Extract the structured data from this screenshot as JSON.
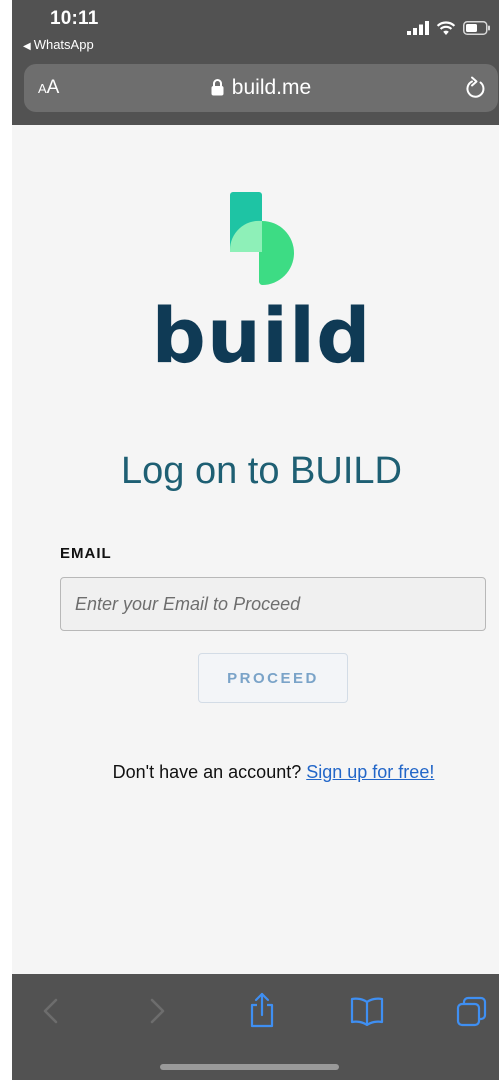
{
  "status_bar": {
    "time": "10:11",
    "back_app": "WhatsApp"
  },
  "browser": {
    "text_size_small": "A",
    "text_size_large": "A",
    "url": "build.me"
  },
  "logo": {
    "wordmark": "build",
    "colors": {
      "teal": "#1ec4a4",
      "light_green": "#8ef0b8",
      "green": "#3ddc84",
      "navy": "#0f3a55"
    }
  },
  "login": {
    "heading": "Log on to BUILD",
    "email_label": "EMAIL",
    "email_placeholder": "Enter your Email to Proceed",
    "email_value": "",
    "proceed_label": "PROCEED",
    "no_account_text": "Don't have an account?",
    "signup_link": "Sign up for free!"
  },
  "toolbar": {
    "icons": [
      "back-icon",
      "forward-icon",
      "share-icon",
      "bookmarks-icon",
      "tabs-icon"
    ]
  }
}
